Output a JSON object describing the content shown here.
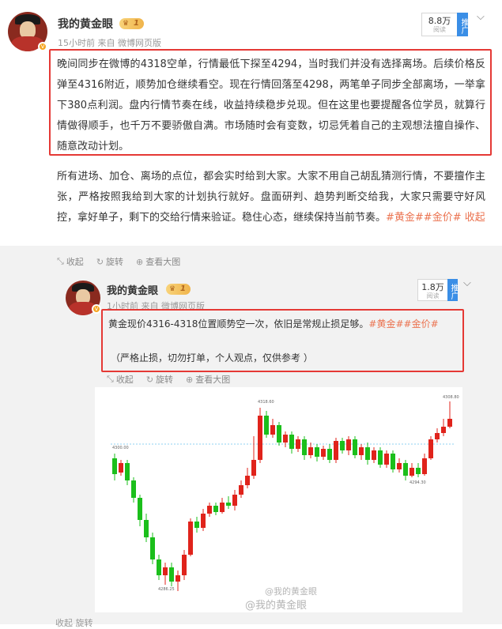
{
  "post": {
    "author": "我的黄金眼",
    "level": "1",
    "time_source": "15小时前 来自 微博网页版",
    "reads_count": "8.8万",
    "reads_label": "阅读",
    "promote": "推广",
    "highlight_text": "晚间同步在微博的4318空单，行情最低下探至4294，当时我们并没有选择离场。后续价格反弹至4316附近，顺势加仓继续看空。现在行情回落至4298，两笔单子同步全部离场，一举拿下380点利润。盘内行情节奏在线，收益持续稳步兑现。但在这里也要提醒各位学员，就算行情做得顺手，也千万不要骄傲自满。市场随时会有变数，切忌凭着自己的主观想法擅自操作、随意改动计划。",
    "body_text": "所有进场、加仓、离场的点位，都会实时给到大家。大家不用自己胡乱猜测行情，不要擅作主张，严格按照我给到大家的计划执行就好。盘面研判、趋势判断交给我，大家只需要守好风控，拿好单子，剩下的交给行情来验证。稳住心态，继续保持当前节奏。",
    "tags": "#黄金##金价#",
    "collapse": "收起",
    "actions": {
      "collect": "收起",
      "rotate": "旋转",
      "view_large": "查看大图"
    }
  },
  "repost": {
    "author": "我的黄金眼",
    "level": "1",
    "time_source": "1小时前 来自 微博网页版",
    "reads_count": "1.8万",
    "reads_label": "阅读",
    "promote": "推广",
    "line1": "黄金现价4316-4318位置顺势空一次，依旧是常规止损足够。",
    "tags": "#黄金##金价#",
    "line2": "（严格止损，切勿打单，个人观点，仅供参考 ）",
    "actions": {
      "collect": "收起",
      "rotate": "旋转",
      "view_large": "查看大图"
    }
  },
  "chart": {
    "labels": {
      "high": "4318.60",
      "mid_left": "4300.00",
      "low": "4286.25",
      "right_low": "4294.30",
      "right_high": "4308.80"
    },
    "colors": {
      "up": "#e0231b",
      "down": "#1bbf1b",
      "ref": "#8fd0f0"
    }
  },
  "watermark": {
    "line1": "@我的黄金眼",
    "line2": "@我的黄金眼"
  },
  "footer": {
    "actions": "收起  旋转"
  }
}
